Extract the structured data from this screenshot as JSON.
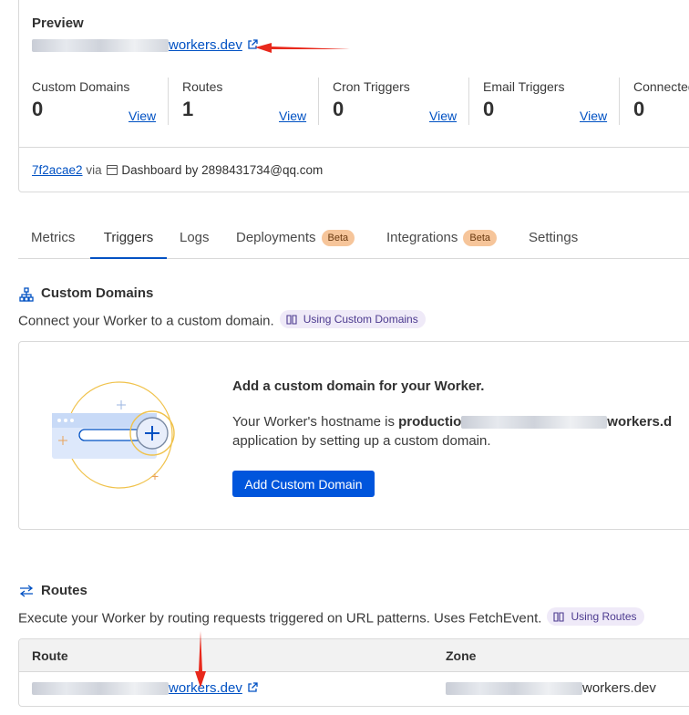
{
  "preview": {
    "title": "Preview",
    "url_suffix": "workers.dev",
    "stats": [
      {
        "label": "Custom Domains",
        "value": "0",
        "action": "View"
      },
      {
        "label": "Routes",
        "value": "1",
        "action": "View"
      },
      {
        "label": "Cron Triggers",
        "value": "0",
        "action": "View"
      },
      {
        "label": "Email Triggers",
        "value": "0",
        "action": "View"
      },
      {
        "label": "Connected",
        "value": "0",
        "action": ""
      }
    ],
    "footer": {
      "version": "7f2acae2",
      "via": "via",
      "source": "Dashboard by 2898431734@qq.com"
    }
  },
  "tabs": [
    {
      "label": "Metrics",
      "badge": ""
    },
    {
      "label": "Triggers",
      "badge": ""
    },
    {
      "label": "Logs",
      "badge": ""
    },
    {
      "label": "Deployments",
      "badge": "Beta"
    },
    {
      "label": "Integrations",
      "badge": "Beta"
    },
    {
      "label": "Settings",
      "badge": ""
    }
  ],
  "custom_domains": {
    "title": "Custom Domains",
    "description": "Connect your Worker to a custom domain.",
    "docs_link": "Using Custom Domains",
    "card_heading": "Add a custom domain for your Worker.",
    "hostname_prefix": "Your Worker's hostname is",
    "hostname_start": "productio",
    "hostname_end": "workers.d",
    "hostname_line2": "application by setting up a custom domain.",
    "button": "Add Custom Domain"
  },
  "routes": {
    "title": "Routes",
    "description": "Execute your Worker by routing requests triggered on URL patterns. Uses FetchEvent.",
    "docs_link": "Using Routes",
    "columns": [
      "Route",
      "Zone"
    ],
    "rows": [
      {
        "route_suffix": "workers.dev",
        "zone_suffix": "workers.dev"
      }
    ]
  },
  "colors": {
    "link": "#0051c3",
    "primary_button": "#0055dc",
    "beta_badge": "#f6c59a",
    "annotation_arrow": "#e8291c"
  }
}
